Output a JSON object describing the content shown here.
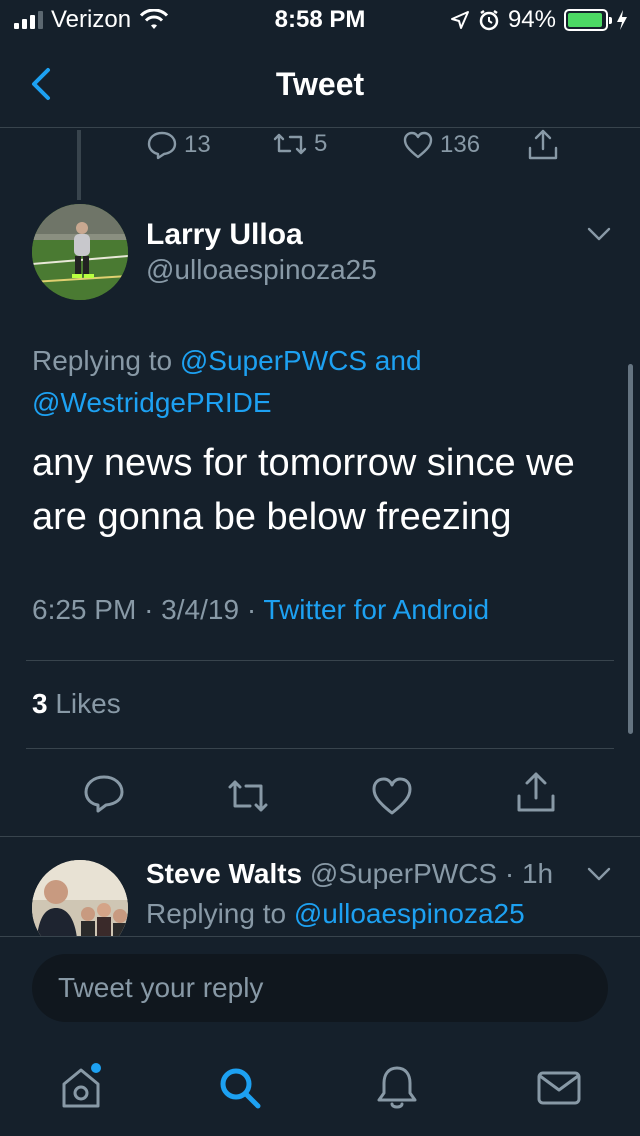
{
  "status_bar": {
    "carrier": "Verizon",
    "time": "8:58 PM",
    "battery": "94%"
  },
  "nav": {
    "title": "Tweet"
  },
  "previous_tweet_actions": {
    "replies": "13",
    "retweets": "5",
    "likes": "136"
  },
  "tweet": {
    "display_name": "Larry Ulloa",
    "handle": "@ulloaespinoza25",
    "replying_prefix": "Replying to",
    "replying_user1": "@SuperPWCS",
    "replying_and": "and",
    "replying_user2": "@WestridgePRIDE",
    "text": "any news for tomorrow since we are gonna be below freezing",
    "time": "6:25 PM",
    "sep1": "·",
    "date": "3/4/19",
    "sep2": "·",
    "source": "Twitter for Android",
    "likes_count": "3",
    "likes_label": "Likes"
  },
  "reply": {
    "display_name": "Steve Walts",
    "handle": "@SuperPWCS",
    "sep": "·",
    "age": "1h",
    "replying_prefix": "Replying to",
    "replying_user": "@ulloaespinoza25"
  },
  "composer": {
    "placeholder": "Tweet your reply"
  },
  "tabs": [
    "home",
    "search",
    "notifications",
    "messages"
  ],
  "colors": {
    "background": "#15202b",
    "accent": "#1da1f2",
    "secondary_text": "#8899a6",
    "divider": "#38444d"
  }
}
